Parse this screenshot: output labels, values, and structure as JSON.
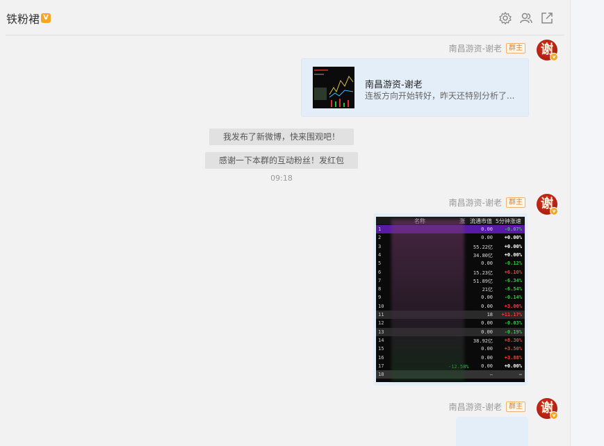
{
  "chat": {
    "title": "铁粉裙",
    "verified_badge": "V"
  },
  "header_icons": [
    "gear-icon",
    "members-icon",
    "popout-icon"
  ],
  "messages": {
    "m1": {
      "sender": "南昌游资-谢老",
      "role_badge": "群主",
      "avatar_char": "谢"
    },
    "card": {
      "title": "南昌游资-谢老",
      "desc": "连板方向开始转好，昨天还特别分析了..."
    },
    "system": [
      "我发布了新微博，快来围观吧！",
      "感谢一下本群的互动粉丝！发红包"
    ],
    "time": "09:18",
    "m2": {
      "sender": "南昌游资-谢老",
      "role_badge": "群主",
      "avatar_char": "谢"
    },
    "m3": {
      "sender": "南昌游资-谢老",
      "role_badge": "群主",
      "avatar_char": "谢"
    }
  },
  "stock_image": {
    "headers": [
      "名称",
      "涨",
      "流通市值",
      "5分钟涨速"
    ],
    "rows": [
      {
        "n": "1",
        "v1": "0.00",
        "v2": "-0.07%",
        "c": "#26d13a",
        "hl": "#5a1aa8"
      },
      {
        "n": "2",
        "v1": "0.00",
        "v2": "+0.00%",
        "c": "#ffffff",
        "hl": ""
      },
      {
        "n": "3",
        "v1": "55.22亿",
        "v2": "+0.00%",
        "c": "#ffffff",
        "hl": ""
      },
      {
        "n": "4",
        "v1": "34.80亿",
        "v2": "+0.00%",
        "c": "#ffffff",
        "hl": ""
      },
      {
        "n": "5",
        "v1": "0.00",
        "v2": "-0.12%",
        "c": "#26d13a",
        "hl": ""
      },
      {
        "n": "6",
        "v1": "15.23亿",
        "v2": "+6.10%",
        "c": "#ff3838",
        "hl": ""
      },
      {
        "n": "7",
        "v1": "51.89亿",
        "v2": "-6.34%",
        "c": "#26d13a",
        "hl": ""
      },
      {
        "n": "8",
        "v1": "21亿",
        "v2": "-6.54%",
        "c": "#26d13a",
        "hl": ""
      },
      {
        "n": "9",
        "v1": "0.00",
        "v2": "-0.14%",
        "c": "#26d13a",
        "hl": ""
      },
      {
        "n": "10",
        "v1": "0.00",
        "v2": "+3.00%",
        "c": "#ff3838",
        "hl": ""
      },
      {
        "n": "11",
        "v1": "18",
        "v2": "+11.17%",
        "c": "#ff3838",
        "hl": "#2a2a2a"
      },
      {
        "n": "12",
        "v1": "0.00",
        "v2": "-0.03%",
        "c": "#26d13a",
        "hl": ""
      },
      {
        "n": "13",
        "v1": "0.00",
        "v2": "-0.19%",
        "c": "#26d13a",
        "hl": "#2a2a2a"
      },
      {
        "n": "14",
        "v1": "38.92亿",
        "v2": "+8.30%",
        "c": "#ff3838",
        "hl": ""
      },
      {
        "n": "15",
        "v1": "0.00",
        "v2": "+3.50%",
        "c": "#ff3838",
        "hl": ""
      },
      {
        "n": "16",
        "v1": "0.00",
        "v2": "+3.88%",
        "c": "#ff3838",
        "hl": ""
      },
      {
        "n": "17",
        "v1": "0.00",
        "v2": "+0.00%",
        "c": "#ffffff",
        "hl": ""
      },
      {
        "n": "18",
        "v1": "—",
        "v2": "—",
        "c": "#bbbbbb",
        "hl": "#333333"
      }
    ],
    "left_col_text": "-12.58%"
  }
}
